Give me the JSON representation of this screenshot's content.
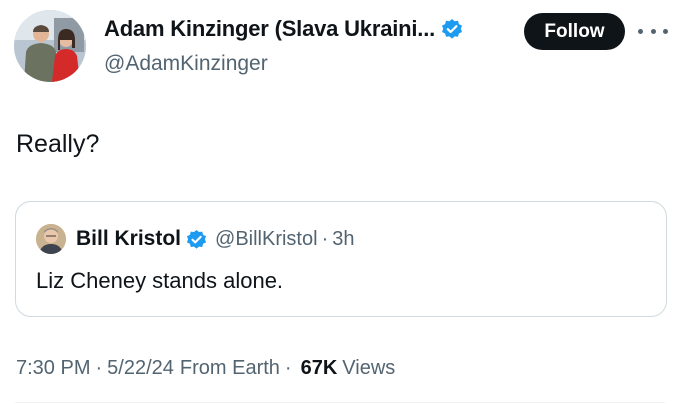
{
  "author": {
    "display_name": "Adam Kinzinger (Slava Ukraini...",
    "handle": "@AdamKinzinger",
    "verified_icon": "verified-badge-icon",
    "avatar_icon": "avatar"
  },
  "actions": {
    "follow_label": "Follow",
    "more_icon": "more-icon"
  },
  "tweet": {
    "text": "Really?"
  },
  "quote": {
    "display_name": "Bill Kristol",
    "handle": "@BillKristol",
    "separator": "·",
    "time": "3h",
    "text": "Liz Cheney stands alone."
  },
  "meta": {
    "time": "7:30 PM",
    "date": "5/22/24",
    "source": "From Earth",
    "separator": "·",
    "views_count": "67K",
    "views_label": "Views"
  },
  "colors": {
    "text_primary": "#0f1419",
    "text_secondary": "#536471",
    "verified_blue": "#1d9bf0",
    "border": "#cfd9de"
  }
}
